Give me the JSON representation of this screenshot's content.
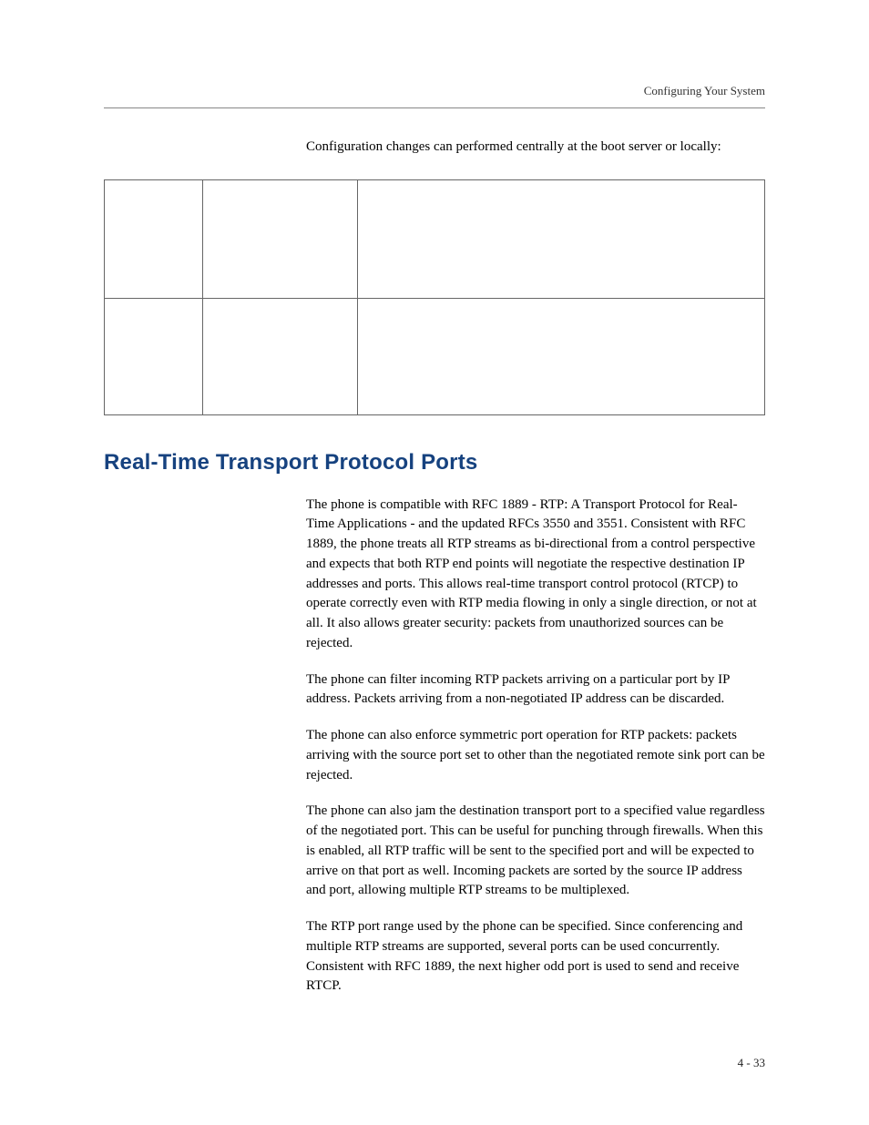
{
  "header": {
    "running_title": "Configuring Your System"
  },
  "lead_in": "Configuration changes can performed centrally at the boot server or locally:",
  "config_table": {
    "rows": [
      {
        "a": "",
        "b": "",
        "c": ""
      },
      {
        "a": "",
        "b": "",
        "c": ""
      }
    ]
  },
  "section": {
    "title": "Real-Time Transport Protocol Ports",
    "paragraphs": [
      "The phone is compatible with RFC 1889 - RTP: A Transport Protocol for Real-Time Applications - and the updated RFCs 3550 and 3551. Consistent with RFC 1889, the phone treats all RTP streams as bi-directional from a control perspective and expects that both RTP end points will negotiate the respective destination IP addresses and ports. This allows real-time transport control protocol (RTCP) to operate correctly even with RTP media flowing in only a single direction, or not at all. It also allows greater security: packets from unauthorized sources can be rejected.",
      "The phone can filter incoming RTP packets arriving on a particular port by IP address. Packets arriving from a non-negotiated IP address can be discarded.",
      "The phone can also enforce symmetric port operation for RTP packets: packets arriving with the source port set to other than the negotiated remote sink port can be rejected.",
      "The phone can also jam the destination transport port to a specified value regardless of the negotiated port. This can be useful for punching through firewalls. When this is enabled, all RTP traffic will be sent to the specified port and will be expected to arrive on that port as well. Incoming packets are sorted by the source IP address and port, allowing multiple RTP streams to be multiplexed.",
      "The RTP port range used by the phone can be specified. Since conferencing and multiple RTP streams are supported, several ports can be used concurrently. Consistent with RFC 1889, the next higher odd port is used to send and receive RTCP."
    ]
  },
  "footer": {
    "page_number": "4 - 33"
  }
}
